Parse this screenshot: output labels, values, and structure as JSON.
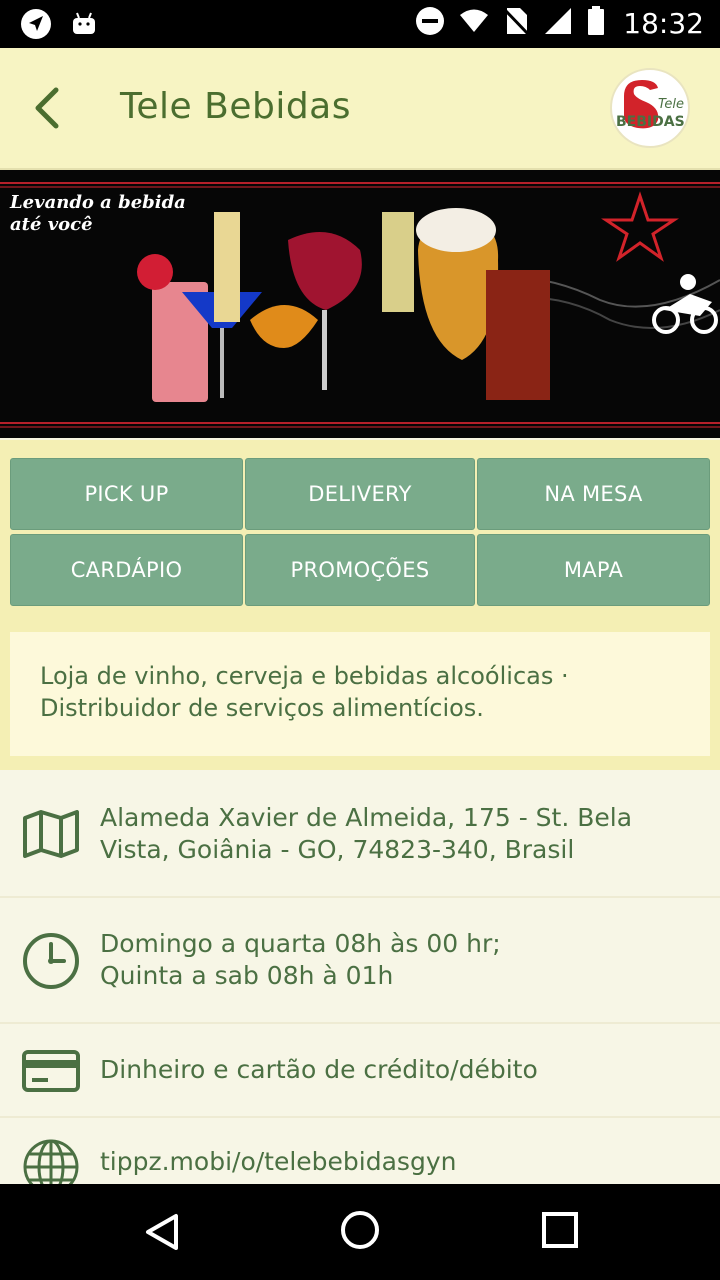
{
  "status_bar": {
    "time": "18:32",
    "icons": [
      "navigation-icon",
      "android-icon",
      "do-not-disturb-icon",
      "wifi-icon",
      "no-sim-icon",
      "signal-icon",
      "battery-icon"
    ]
  },
  "app_bar": {
    "title": "Tele Bebidas",
    "logo_text_top": "Tele",
    "logo_text_bottom": "BEBIDAS"
  },
  "banner": {
    "slogan_line1": "Levando a bebida",
    "slogan_line2": "até você"
  },
  "actions": [
    {
      "label": "PICK UP"
    },
    {
      "label": "DELIVERY"
    },
    {
      "label": "NA MESA"
    },
    {
      "label": "CARDÁPIO"
    },
    {
      "label": "PROMOÇÕES"
    },
    {
      "label": "MAPA"
    }
  ],
  "description": {
    "line1": "Loja de vinho, cerveja e bebidas alcoólicas ·",
    "line2": "Distribuidor de serviços alimentícios."
  },
  "info": {
    "address_line1": "Alameda Xavier de Almeida, 175 - St. Bela",
    "address_line2": "Vista, Goiânia - GO, 74823-340, Brasil",
    "hours_line1": "Domingo a quarta 08h às 00 hr;",
    "hours_line2": "Quinta a sab 08h à 01h",
    "payment": "Dinheiro e cartão de crédito/débito",
    "website": "tippz.mobi/o/telebebidasgyn"
  },
  "colors": {
    "accent": "#4b7043",
    "button": "#7aab8b",
    "app_bar": "#f7f4c3",
    "brand_red": "#d2232a"
  }
}
